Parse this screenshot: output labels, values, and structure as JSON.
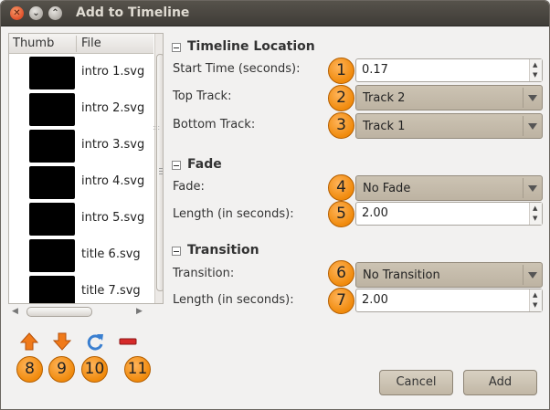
{
  "window": {
    "title": "Add to Timeline"
  },
  "filelist": {
    "col_thumb": "Thumb",
    "col_file": "File",
    "files": [
      {
        "name": "intro 1.svg"
      },
      {
        "name": "intro 2.svg"
      },
      {
        "name": "intro 3.svg"
      },
      {
        "name": "intro 4.svg"
      },
      {
        "name": "intro 5.svg"
      },
      {
        "name": "title 6.svg"
      },
      {
        "name": "title 7.svg"
      }
    ]
  },
  "timeline_location": {
    "heading": "Timeline Location",
    "start_time_label": "Start Time (seconds):",
    "start_time_value": "0.17",
    "top_track_label": "Top Track:",
    "top_track_value": "Track 2",
    "bottom_track_label": "Bottom Track:",
    "bottom_track_value": "Track 1"
  },
  "fade": {
    "heading": "Fade",
    "fade_label": "Fade:",
    "fade_value": "No Fade",
    "length_label": "Length (in seconds):",
    "length_value": "2.00"
  },
  "transition": {
    "heading": "Transition",
    "transition_label": "Transition:",
    "transition_value": "No Transition",
    "length_label": "Length (in seconds):",
    "length_value": "2.00"
  },
  "badges": [
    "1",
    "2",
    "3",
    "4",
    "5",
    "6",
    "7",
    "8",
    "9",
    "10",
    "11"
  ],
  "buttons": {
    "cancel": "Cancel",
    "add": "Add"
  },
  "icons": {
    "move_up": "arrow-up-icon",
    "move_down": "arrow-down-icon",
    "refresh": "refresh-icon",
    "remove": "remove-icon"
  },
  "colors": {
    "accent_badge": "#f08a0c",
    "remove_red": "#d62a2a",
    "refresh_blue": "#3a7fd0",
    "arrow_orange": "#f07a1a"
  }
}
